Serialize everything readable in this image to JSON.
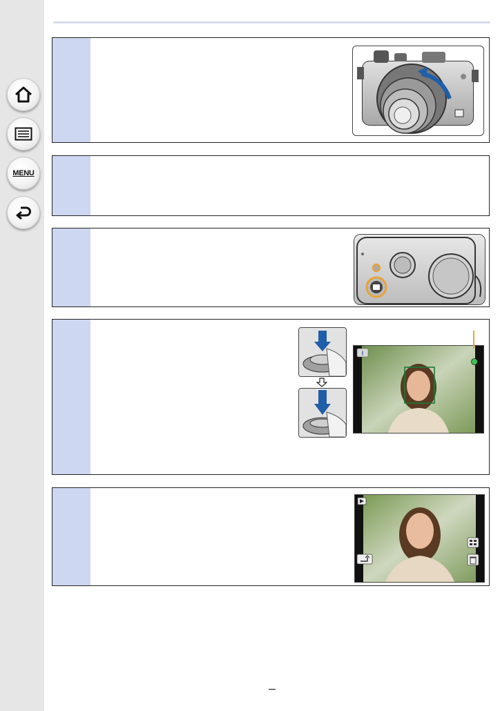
{
  "sidebar": {
    "items": [
      {
        "id": "home",
        "icon": "home-icon"
      },
      {
        "id": "contents",
        "icon": "list-icon"
      },
      {
        "id": "menu",
        "icon": "menu-text-icon",
        "label": "MENU"
      },
      {
        "id": "back",
        "icon": "back-arrow-icon"
      }
    ]
  },
  "colors": {
    "sidebar_bg": "#e6e6e6",
    "step_tab": "#cdd7f1",
    "accent_blue": "#1f5ea8",
    "af_frame_green": "#1d7a3a",
    "focus_indicator": "#3fbf5a",
    "highlight_orange": "#e8a23a"
  },
  "step4": {
    "indicator_mark": "i"
  }
}
